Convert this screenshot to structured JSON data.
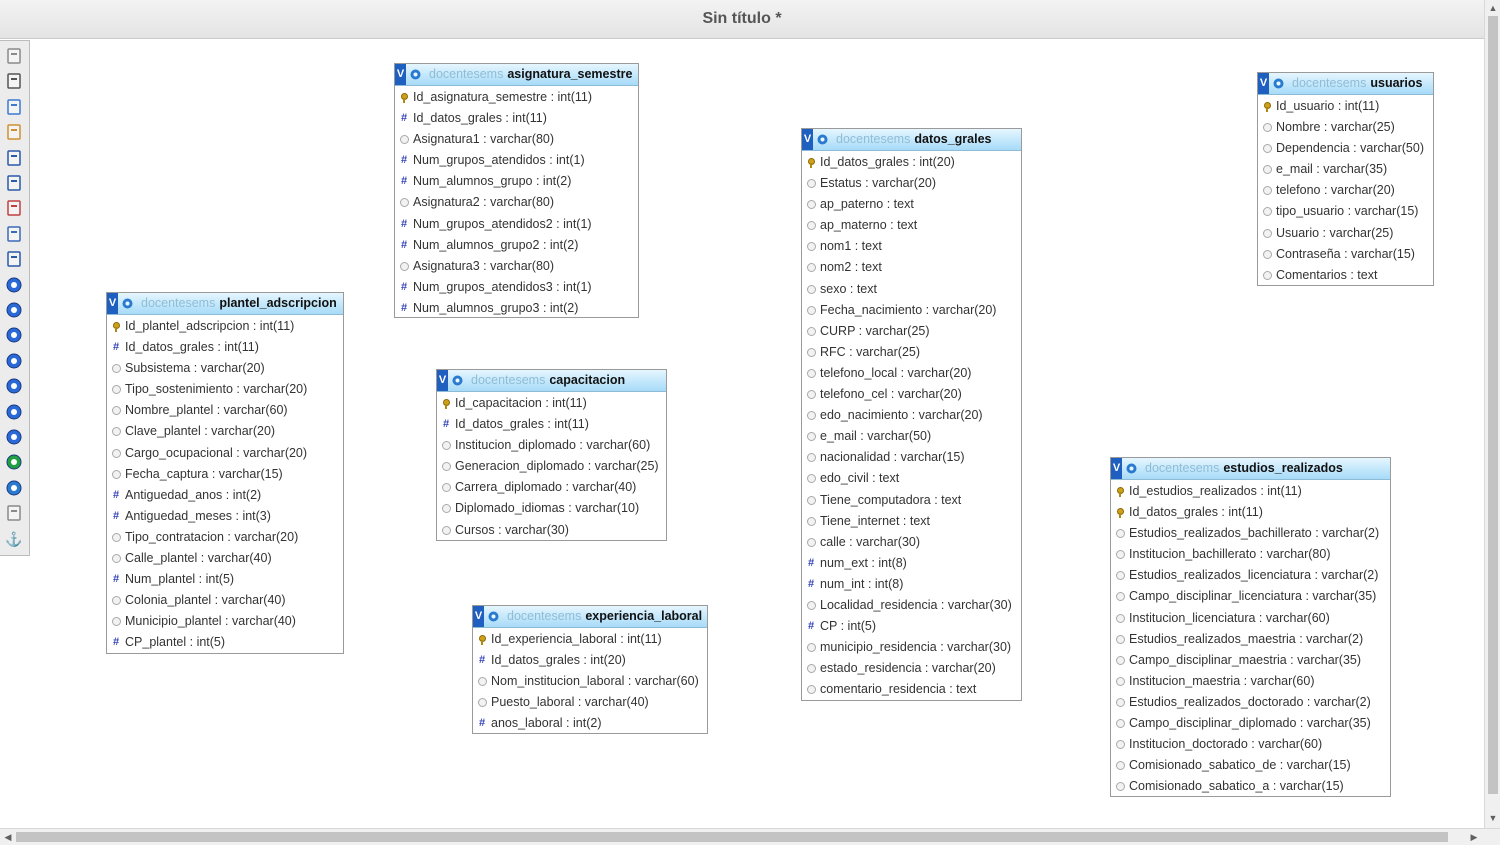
{
  "window": {
    "title": "Sin título *"
  },
  "toolbar": {
    "buttons": [
      {
        "name": "undo-icon"
      },
      {
        "name": "fit-screen-icon"
      },
      {
        "name": "new-document-icon"
      },
      {
        "name": "edit-document-icon"
      },
      {
        "name": "save-icon"
      },
      {
        "name": "save-as-icon"
      },
      {
        "name": "export-icon"
      },
      {
        "name": "page-icon"
      },
      {
        "name": "relation-icon"
      },
      {
        "name": "zoom-in-icon"
      },
      {
        "name": "zoom-out-icon"
      },
      {
        "name": "help-icon"
      },
      {
        "name": "global-icon"
      },
      {
        "name": "toggle-icon"
      },
      {
        "name": "refresh-icon"
      },
      {
        "name": "settings-icon"
      },
      {
        "name": "view-icon"
      },
      {
        "name": "document-icon"
      },
      {
        "name": "back-icon"
      },
      {
        "name": "anchor-icon"
      }
    ]
  },
  "tables": [
    {
      "id": "asignatura_semestre",
      "db": "docentesems",
      "name": "asignatura_semestre",
      "columns": [
        {
          "t": "key",
          "text": "Id_asignatura_semestre : int(11)"
        },
        {
          "t": "num",
          "text": "Id_datos_grales : int(11)"
        },
        {
          "t": "txt",
          "text": "Asignatura1 : varchar(80)"
        },
        {
          "t": "num",
          "text": "Num_grupos_atendidos : int(1)"
        },
        {
          "t": "num",
          "text": "Num_alumnos_grupo : int(2)"
        },
        {
          "t": "txt",
          "text": "Asignatura2 : varchar(80)"
        },
        {
          "t": "num",
          "text": "Num_grupos_atendidos2 : int(1)"
        },
        {
          "t": "num",
          "text": "Num_alumnos_grupo2 : int(2)"
        },
        {
          "t": "txt",
          "text": "Asignatura3 : varchar(80)"
        },
        {
          "t": "num",
          "text": "Num_grupos_atendidos3 : int(1)"
        },
        {
          "t": "num",
          "text": "Num_alumnos_grupo3 : int(2)"
        }
      ]
    },
    {
      "id": "usuarios",
      "db": "docentesems",
      "name": "usuarios",
      "columns": [
        {
          "t": "key",
          "text": "Id_usuario : int(11)"
        },
        {
          "t": "txt",
          "text": "Nombre : varchar(25)"
        },
        {
          "t": "txt",
          "text": "Dependencia : varchar(50)"
        },
        {
          "t": "txt",
          "text": "e_mail : varchar(35)"
        },
        {
          "t": "txt",
          "text": "telefono : varchar(20)"
        },
        {
          "t": "txt",
          "text": "tipo_usuario : varchar(15)"
        },
        {
          "t": "txt",
          "text": "Usuario : varchar(25)"
        },
        {
          "t": "txt",
          "text": "Contraseña : varchar(15)"
        },
        {
          "t": "txt",
          "text": "Comentarios : text"
        }
      ]
    },
    {
      "id": "datos_grales",
      "db": "docentesems",
      "name": "datos_grales",
      "columns": [
        {
          "t": "key",
          "text": "Id_datos_grales : int(20)"
        },
        {
          "t": "txt",
          "text": "Estatus : varchar(20)"
        },
        {
          "t": "txt",
          "text": "ap_paterno : text"
        },
        {
          "t": "txt",
          "text": "ap_materno : text"
        },
        {
          "t": "txt",
          "text": "nom1 : text"
        },
        {
          "t": "txt",
          "text": "nom2 : text"
        },
        {
          "t": "txt",
          "text": "sexo : text"
        },
        {
          "t": "txt",
          "text": "Fecha_nacimiento : varchar(20)"
        },
        {
          "t": "txt",
          "text": "CURP : varchar(25)"
        },
        {
          "t": "txt",
          "text": "RFC : varchar(25)"
        },
        {
          "t": "txt",
          "text": "telefono_local : varchar(20)"
        },
        {
          "t": "txt",
          "text": "telefono_cel : varchar(20)"
        },
        {
          "t": "txt",
          "text": "edo_nacimiento : varchar(20)"
        },
        {
          "t": "txt",
          "text": "e_mail : varchar(50)"
        },
        {
          "t": "txt",
          "text": "nacionalidad : varchar(15)"
        },
        {
          "t": "txt",
          "text": "edo_civil : text"
        },
        {
          "t": "txt",
          "text": "Tiene_computadora : text"
        },
        {
          "t": "txt",
          "text": "Tiene_internet : text"
        },
        {
          "t": "txt",
          "text": "calle : varchar(30)"
        },
        {
          "t": "num",
          "text": "num_ext : int(8)"
        },
        {
          "t": "num",
          "text": "num_int : int(8)"
        },
        {
          "t": "txt",
          "text": "Localidad_residencia : varchar(30)"
        },
        {
          "t": "num",
          "text": "CP : int(5)"
        },
        {
          "t": "txt",
          "text": "municipio_residencia : varchar(30)"
        },
        {
          "t": "txt",
          "text": "estado_residencia : varchar(20)"
        },
        {
          "t": "txt",
          "text": "comentario_residencia : text"
        }
      ]
    },
    {
      "id": "plantel_adscripcion",
      "db": "docentesems",
      "name": "plantel_adscripcion",
      "columns": [
        {
          "t": "key",
          "text": "Id_plantel_adscripcion : int(11)"
        },
        {
          "t": "num",
          "text": "Id_datos_grales : int(11)"
        },
        {
          "t": "txt",
          "text": "Subsistema : varchar(20)"
        },
        {
          "t": "txt",
          "text": "Tipo_sostenimiento : varchar(20)"
        },
        {
          "t": "txt",
          "text": "Nombre_plantel : varchar(60)"
        },
        {
          "t": "txt",
          "text": "Clave_plantel : varchar(20)"
        },
        {
          "t": "txt",
          "text": "Cargo_ocupacional : varchar(20)"
        },
        {
          "t": "txt",
          "text": "Fecha_captura : varchar(15)"
        },
        {
          "t": "num",
          "text": "Antiguedad_anos : int(2)"
        },
        {
          "t": "num",
          "text": "Antiguedad_meses : int(3)"
        },
        {
          "t": "txt",
          "text": "Tipo_contratacion : varchar(20)"
        },
        {
          "t": "txt",
          "text": "Calle_plantel : varchar(40)"
        },
        {
          "t": "num",
          "text": "Num_plantel : int(5)"
        },
        {
          "t": "txt",
          "text": "Colonia_plantel : varchar(40)"
        },
        {
          "t": "txt",
          "text": "Municipio_plantel : varchar(40)"
        },
        {
          "t": "num",
          "text": "CP_plantel : int(5)"
        }
      ]
    },
    {
      "id": "capacitacion",
      "db": "docentesems",
      "name": "capacitacion",
      "columns": [
        {
          "t": "key",
          "text": "Id_capacitacion : int(11)"
        },
        {
          "t": "num",
          "text": "Id_datos_grales : int(11)"
        },
        {
          "t": "txt",
          "text": "Institucion_diplomado : varchar(60)"
        },
        {
          "t": "txt",
          "text": "Generacion_diplomado : varchar(25)"
        },
        {
          "t": "txt",
          "text": "Carrera_diplomado : varchar(40)"
        },
        {
          "t": "txt",
          "text": "Diplomado_idiomas : varchar(10)"
        },
        {
          "t": "txt",
          "text": "Cursos : varchar(30)"
        }
      ]
    },
    {
      "id": "experiencia_laboral",
      "db": "docentesems",
      "name": "experiencia_laboral",
      "columns": [
        {
          "t": "key",
          "text": "Id_experiencia_laboral : int(11)"
        },
        {
          "t": "num",
          "text": "Id_datos_grales : int(20)"
        },
        {
          "t": "txt",
          "text": "Nom_institucion_laboral : varchar(60)"
        },
        {
          "t": "txt",
          "text": "Puesto_laboral : varchar(40)"
        },
        {
          "t": "num",
          "text": "anos_laboral : int(2)"
        }
      ]
    },
    {
      "id": "estudios_realizados",
      "db": "docentesems",
      "name": "estudios_realizados",
      "columns": [
        {
          "t": "key",
          "text": "Id_estudios_realizados : int(11)"
        },
        {
          "t": "key",
          "text": "Id_datos_grales : int(11)"
        },
        {
          "t": "txt",
          "text": "Estudios_realizados_bachillerato : varchar(2)"
        },
        {
          "t": "txt",
          "text": "Institucion_bachillerato : varchar(80)"
        },
        {
          "t": "txt",
          "text": "Estudios_realizados_licenciatura : varchar(2)"
        },
        {
          "t": "txt",
          "text": "Campo_disciplinar_licenciatura : varchar(35)"
        },
        {
          "t": "txt",
          "text": "Institucion_licenciatura : varchar(60)"
        },
        {
          "t": "txt",
          "text": "Estudios_realizados_maestria : varchar(2)"
        },
        {
          "t": "txt",
          "text": "Campo_disciplinar_maestria : varchar(35)"
        },
        {
          "t": "txt",
          "text": "Institucion_maestria : varchar(60)"
        },
        {
          "t": "txt",
          "text": "Estudios_realizados_doctorado : varchar(2)"
        },
        {
          "t": "txt",
          "text": "Campo_disciplinar_diplomado : varchar(35)"
        },
        {
          "t": "txt",
          "text": "Institucion_doctorado : varchar(60)"
        },
        {
          "t": "txt",
          "text": "Comisionado_sabatico_de : varchar(15)"
        },
        {
          "t": "txt",
          "text": "Comisionado_sabatico_a : varchar(15)"
        }
      ]
    }
  ]
}
